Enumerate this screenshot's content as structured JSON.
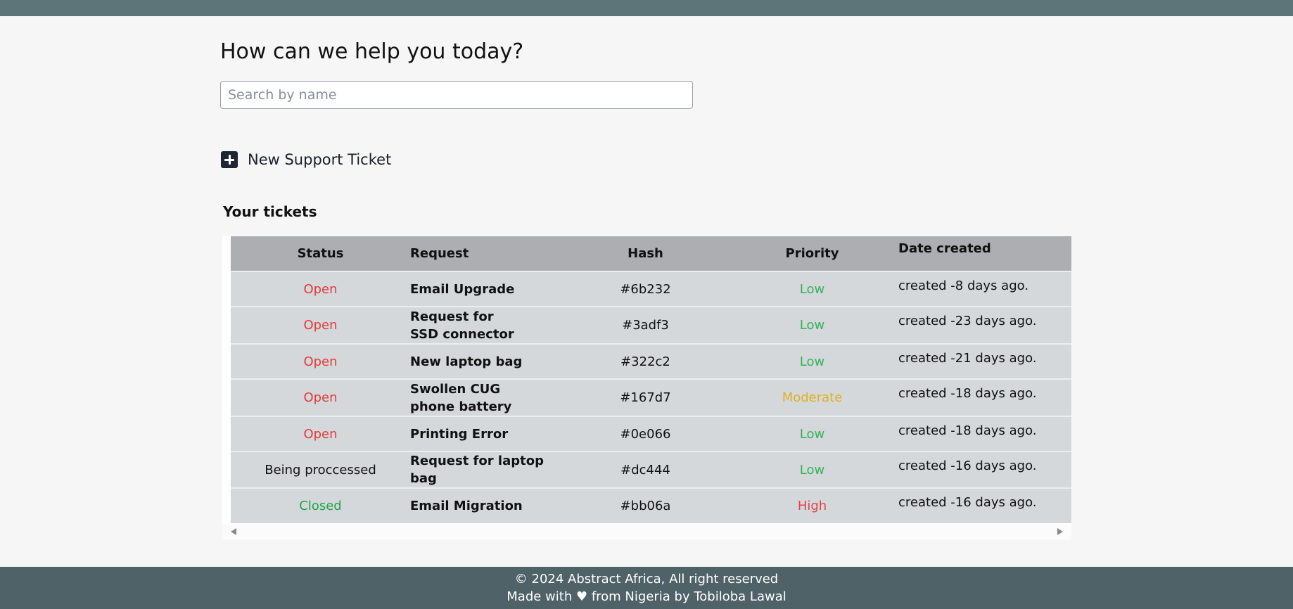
{
  "page": {
    "title": "How can we help you today?"
  },
  "search": {
    "placeholder": "Search by name",
    "value": ""
  },
  "new_ticket": {
    "icon": "plus-square-icon",
    "label": "New Support Ticket"
  },
  "tickets": {
    "section_title": "Your tickets",
    "columns": [
      "Status",
      "Request",
      "Hash",
      "Priority",
      "Date created"
    ],
    "rows": [
      {
        "status": "Open",
        "request": "Email Upgrade",
        "hash": "#6b232",
        "priority": "Low",
        "date": "created -8 days ago."
      },
      {
        "status": "Open",
        "request": "Request for SSD connector",
        "hash": "#3adf3",
        "priority": "Low",
        "date": "created -23 days ago."
      },
      {
        "status": "Open",
        "request": "New laptop bag",
        "hash": "#322c2",
        "priority": "Low",
        "date": "created -21 days ago."
      },
      {
        "status": "Open",
        "request": "Swollen CUG phone battery",
        "hash": "#167d7",
        "priority": "Moderate",
        "date": "created -18 days ago."
      },
      {
        "status": "Open",
        "request": "Printing Error",
        "hash": "#0e066",
        "priority": "Low",
        "date": "created -18 days ago."
      },
      {
        "status": "Being proccessed",
        "request": "Request for laptop bag",
        "hash": "#dc444",
        "priority": "Low",
        "date": "created -16 days ago."
      },
      {
        "status": "Closed",
        "request": "Email Migration",
        "hash": "#bb06a",
        "priority": "High",
        "date": "created -16 days ago."
      }
    ]
  },
  "colors": {
    "status_open": "#e23b3b",
    "status_closed": "#1fa34a",
    "status_processing": "#111111",
    "priority_low": "#35b35a",
    "priority_moderate": "#e0b020",
    "priority_high": "#e04545",
    "topbar": "#5d7478",
    "footer": "#4f6268"
  },
  "footer": {
    "copyright": "© 2024 Abstract Africa, All right reserved",
    "made_with": "Made with ♥ from Nigeria by Tobiloba Lawal"
  }
}
